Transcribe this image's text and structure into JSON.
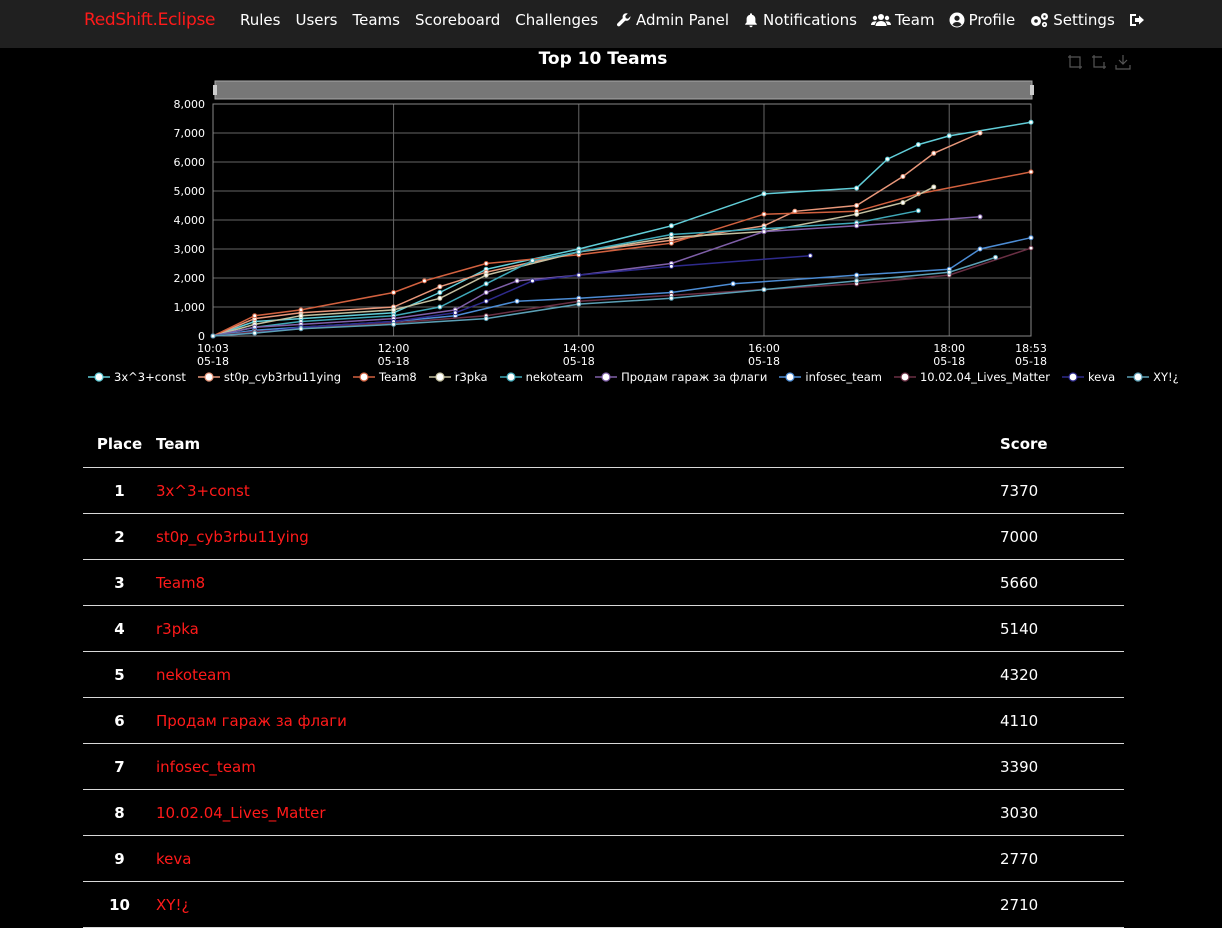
{
  "nav": {
    "brand": "RedShift.Eclipse",
    "links": [
      "Rules",
      "Users",
      "Teams",
      "Scoreboard",
      "Challenges"
    ],
    "admin_panel": "Admin Panel",
    "notifications": "Notifications",
    "team": "Team",
    "profile": "Profile",
    "settings": "Settings"
  },
  "chart_data": {
    "type": "line",
    "title": "Top 10 Teams",
    "ylim": [
      0,
      8000
    ],
    "y_ticks": [
      "0",
      "1,000",
      "2,000",
      "3,000",
      "4,000",
      "5,000",
      "6,000",
      "7,000",
      "8,000"
    ],
    "x_ticks": [
      {
        "time": "10:03",
        "date": "05-18"
      },
      {
        "time": "12:00",
        "date": "05-18"
      },
      {
        "time": "14:00",
        "date": "05-18"
      },
      {
        "time": "16:00",
        "date": "05-18"
      },
      {
        "time": "18:00",
        "date": "05-18"
      },
      {
        "time": "18:53",
        "date": "05-18"
      }
    ],
    "xlim": [
      "10:03",
      "18:53"
    ],
    "grid": true,
    "legend_position": "bottom",
    "series": [
      {
        "name": "3x^3+const",
        "color": "#61cdd8",
        "points": [
          [
            "10:03",
            0
          ],
          [
            "10:30",
            500
          ],
          [
            "11:00",
            600
          ],
          [
            "12:00",
            800
          ],
          [
            "12:30",
            1500
          ],
          [
            "13:00",
            2300
          ],
          [
            "14:00",
            3000
          ],
          [
            "15:00",
            3800
          ],
          [
            "16:00",
            4900
          ],
          [
            "17:00",
            5100
          ],
          [
            "17:20",
            6100
          ],
          [
            "17:40",
            6600
          ],
          [
            "18:00",
            6900
          ],
          [
            "18:53",
            7370
          ]
        ]
      },
      {
        "name": "st0p_cyb3rbu11ying",
        "color": "#e8977a",
        "points": [
          [
            "10:03",
            0
          ],
          [
            "10:30",
            600
          ],
          [
            "11:00",
            800
          ],
          [
            "12:00",
            1000
          ],
          [
            "12:30",
            1700
          ],
          [
            "13:00",
            2200
          ],
          [
            "14:00",
            2900
          ],
          [
            "15:00",
            3300
          ],
          [
            "16:00",
            3800
          ],
          [
            "16:20",
            4300
          ],
          [
            "17:00",
            4500
          ],
          [
            "17:30",
            5500
          ],
          [
            "17:50",
            6300
          ],
          [
            "18:20",
            7000
          ]
        ]
      },
      {
        "name": "Team8",
        "color": "#d2613f",
        "points": [
          [
            "10:03",
            0
          ],
          [
            "10:30",
            700
          ],
          [
            "11:00",
            900
          ],
          [
            "12:00",
            1500
          ],
          [
            "12:20",
            1900
          ],
          [
            "13:00",
            2500
          ],
          [
            "14:00",
            2800
          ],
          [
            "15:00",
            3200
          ],
          [
            "16:00",
            4200
          ],
          [
            "17:00",
            4300
          ],
          [
            "17:40",
            4900
          ],
          [
            "18:53",
            5660
          ]
        ]
      },
      {
        "name": "r3pka",
        "color": "#c4c0a0",
        "points": [
          [
            "10:03",
            0
          ],
          [
            "10:30",
            400
          ],
          [
            "11:00",
            700
          ],
          [
            "12:00",
            900
          ],
          [
            "12:30",
            1300
          ],
          [
            "13:00",
            2100
          ],
          [
            "14:00",
            2900
          ],
          [
            "15:00",
            3400
          ],
          [
            "16:00",
            3600
          ],
          [
            "17:00",
            4200
          ],
          [
            "17:30",
            4600
          ],
          [
            "17:50",
            5140
          ]
        ]
      },
      {
        "name": "nekoteam",
        "color": "#3fa8b8",
        "points": [
          [
            "10:03",
            0
          ],
          [
            "10:30",
            300
          ],
          [
            "11:00",
            500
          ],
          [
            "12:00",
            700
          ],
          [
            "12:30",
            1000
          ],
          [
            "13:00",
            1800
          ],
          [
            "13:30",
            2600
          ],
          [
            "14:00",
            2900
          ],
          [
            "15:00",
            3500
          ],
          [
            "16:00",
            3700
          ],
          [
            "17:00",
            3900
          ],
          [
            "17:40",
            4320
          ]
        ]
      },
      {
        "name": "Продам гараж за флаги",
        "color": "#7f5fa8",
        "points": [
          [
            "10:03",
            0
          ],
          [
            "10:30",
            300
          ],
          [
            "11:00",
            400
          ],
          [
            "12:00",
            600
          ],
          [
            "12:40",
            900
          ],
          [
            "13:00",
            1500
          ],
          [
            "13:20",
            1900
          ],
          [
            "14:00",
            2100
          ],
          [
            "15:00",
            2500
          ],
          [
            "16:00",
            3600
          ],
          [
            "17:00",
            3800
          ],
          [
            "18:20",
            4110
          ]
        ]
      },
      {
        "name": "infosec_team",
        "color": "#4c8cd4",
        "points": [
          [
            "10:03",
            0
          ],
          [
            "10:30",
            200
          ],
          [
            "11:00",
            300
          ],
          [
            "12:00",
            500
          ],
          [
            "12:40",
            700
          ],
          [
            "13:20",
            1200
          ],
          [
            "14:00",
            1300
          ],
          [
            "15:00",
            1500
          ],
          [
            "15:40",
            1800
          ],
          [
            "17:00",
            2100
          ],
          [
            "18:00",
            2300
          ],
          [
            "18:20",
            3000
          ],
          [
            "18:53",
            3390
          ]
        ]
      },
      {
        "name": "10.02.04_Lives_Matter",
        "color": "#6a2f44",
        "points": [
          [
            "10:03",
            0
          ],
          [
            "10:30",
            150
          ],
          [
            "11:00",
            250
          ],
          [
            "12:00",
            450
          ],
          [
            "13:00",
            700
          ],
          [
            "14:00",
            1200
          ],
          [
            "15:00",
            1400
          ],
          [
            "16:00",
            1600
          ],
          [
            "17:00",
            1800
          ],
          [
            "18:00",
            2100
          ],
          [
            "18:53",
            3030
          ]
        ]
      },
      {
        "name": "keva",
        "color": "#2e2a8c",
        "points": [
          [
            "10:03",
            0
          ],
          [
            "10:30",
            100
          ],
          [
            "11:00",
            300
          ],
          [
            "12:00",
            500
          ],
          [
            "12:40",
            800
          ],
          [
            "13:00",
            1200
          ],
          [
            "13:30",
            1900
          ],
          [
            "14:00",
            2100
          ],
          [
            "15:00",
            2400
          ],
          [
            "16:30",
            2770
          ]
        ]
      },
      {
        "name": "XY!¿",
        "color": "#5b9fb5",
        "points": [
          [
            "10:03",
            0
          ],
          [
            "10:30",
            100
          ],
          [
            "11:00",
            250
          ],
          [
            "12:00",
            400
          ],
          [
            "13:00",
            600
          ],
          [
            "14:00",
            1100
          ],
          [
            "15:00",
            1300
          ],
          [
            "16:00",
            1600
          ],
          [
            "17:00",
            1900
          ],
          [
            "18:00",
            2200
          ],
          [
            "18:30",
            2710
          ]
        ]
      }
    ]
  },
  "scoreboard": {
    "headers": {
      "place": "Place",
      "team": "Team",
      "score": "Score"
    },
    "rows": [
      {
        "place": "1",
        "team": "3x^3+const",
        "score": "7370"
      },
      {
        "place": "2",
        "team": "st0p_cyb3rbu11ying",
        "score": "7000"
      },
      {
        "place": "3",
        "team": "Team8",
        "score": "5660"
      },
      {
        "place": "4",
        "team": "r3pka",
        "score": "5140"
      },
      {
        "place": "5",
        "team": "nekoteam",
        "score": "4320"
      },
      {
        "place": "6",
        "team": "Продам гараж за флаги",
        "score": "4110"
      },
      {
        "place": "7",
        "team": "infosec_team",
        "score": "3390"
      },
      {
        "place": "8",
        "team": "10.02.04_Lives_Matter",
        "score": "3030"
      },
      {
        "place": "9",
        "team": "keva",
        "score": "2770"
      },
      {
        "place": "10",
        "team": "XY!¿",
        "score": "2710"
      }
    ]
  }
}
